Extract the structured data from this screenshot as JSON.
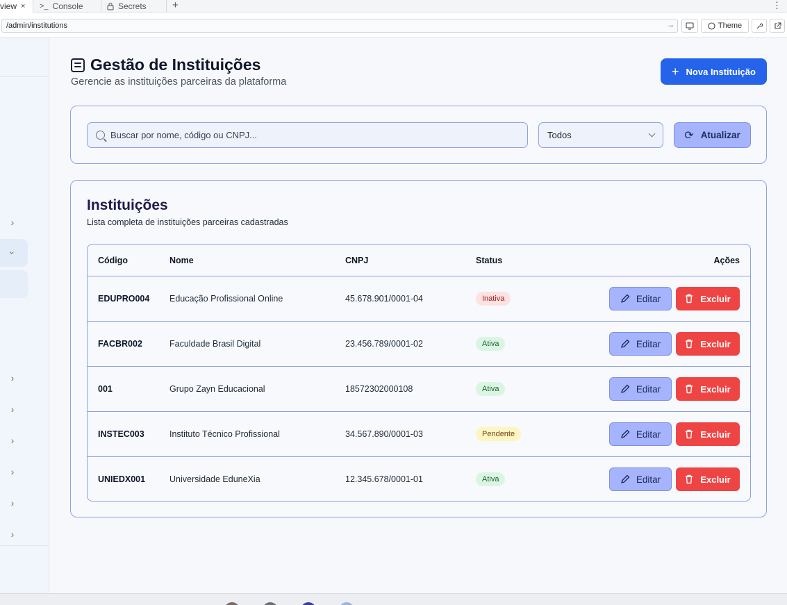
{
  "browser": {
    "tabs": [
      {
        "label": "view",
        "close": "×"
      },
      {
        "label": "Console",
        "icon": ">_"
      },
      {
        "label": "Secrets",
        "icon": "lock"
      }
    ],
    "new_tab": "+",
    "menu": "⋮",
    "url": "/admin/institutions",
    "theme_label": "Theme"
  },
  "header": {
    "title": "Gestão de Instituições",
    "subtitle": "Gerencie as instituições parceiras da plataforma",
    "new_button": "Nova Instituição"
  },
  "filters": {
    "search_placeholder": "Buscar por nome, código ou CNPJ...",
    "status_selected": "Todos",
    "refresh_label": "Atualizar"
  },
  "list": {
    "title": "Instituições",
    "subtitle": "Lista completa de instituições parceiras cadastradas",
    "columns": [
      "Código",
      "Nome",
      "CNPJ",
      "Status",
      "Ações"
    ],
    "rows": [
      {
        "code": "EDUPRO004",
        "name": "Educação Profissional Online",
        "cnpj": "45.678.901/0001-04",
        "status": "Inativa"
      },
      {
        "code": "FACBR002",
        "name": "Faculdade Brasil Digital",
        "cnpj": "23.456.789/0001-02",
        "status": "Ativa"
      },
      {
        "code": "001",
        "name": "Grupo Zayn Educacional",
        "cnpj": "18572302000108",
        "status": "Ativa"
      },
      {
        "code": "INSTEC003",
        "name": "Instituto Técnico Profissional",
        "cnpj": "34.567.890/0001-03",
        "status": "Pendente"
      },
      {
        "code": "UNIEDX001",
        "name": "Universidade EduneXia",
        "cnpj": "12.345.678/0001-01",
        "status": "Ativa"
      }
    ],
    "edit_label": "Editar",
    "delete_label": "Excluir"
  },
  "colors": {
    "primary": "#2563eb",
    "accent_soft": "#a5b4fc",
    "danger": "#ef4444",
    "border": "#8ea0e8"
  }
}
